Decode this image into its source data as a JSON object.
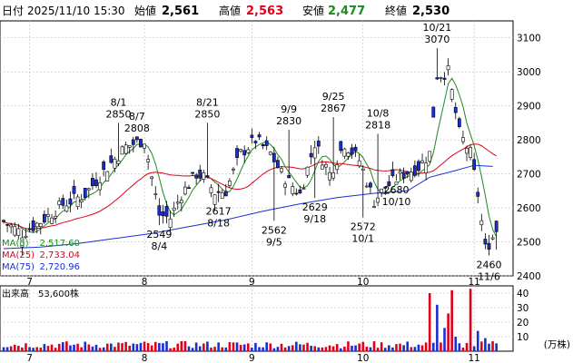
{
  "header": {
    "label_date": "日付",
    "date": "2025/11/10 15:30",
    "label_open": "始値",
    "open": "2,561",
    "label_high": "高値",
    "high": "2,563",
    "label_low": "安値",
    "low": "2,477",
    "label_close": "終値",
    "close": "2,530"
  },
  "colors": {
    "up": "#ffffff",
    "down": "#1a2fd0",
    "candle_outline": "#000000",
    "high_value": "#e0001a",
    "low_value": "#1f8a1f",
    "ma5": "#1f8a1f",
    "ma25": "#e0001a",
    "ma75": "#1a2fd0",
    "volume_up": "#e0001a",
    "volume_down": "#1a2fd0",
    "grid": "#bdbdbd"
  },
  "chart_data": [
    {
      "type": "candlestick",
      "ylim": [
        2400,
        3150
      ],
      "y_ticks": [
        "3100",
        "3000",
        "2900",
        "2800",
        "2700",
        "2600",
        "2500",
        "2400"
      ],
      "x_ticks": [
        "7",
        "8",
        "9",
        "10",
        "11"
      ],
      "annotations": [
        {
          "date": "8/1",
          "value": "2850",
          "position": "above"
        },
        {
          "date": "8/7",
          "value": "2808",
          "position": "above"
        },
        {
          "date": "8/21",
          "value": "2850",
          "position": "above"
        },
        {
          "date": "9/9",
          "value": "2830",
          "position": "above"
        },
        {
          "date": "9/25",
          "value": "2867",
          "position": "above"
        },
        {
          "date": "10/8",
          "value": "2818",
          "position": "above"
        },
        {
          "date": "10/21",
          "value": "3070",
          "position": "above"
        },
        {
          "date": "8/4",
          "value": "2549",
          "position": "below"
        },
        {
          "date": "8/18",
          "value": "2617",
          "position": "below"
        },
        {
          "date": "9/5",
          "value": "2562",
          "position": "below"
        },
        {
          "date": "9/18",
          "value": "2629",
          "position": "below"
        },
        {
          "date": "10/1",
          "value": "2572",
          "position": "below"
        },
        {
          "date": "10/10",
          "value": "2680",
          "position": "below"
        },
        {
          "date": "11/6",
          "value": "2460",
          "position": "below"
        }
      ],
      "moving_averages": [
        {
          "name": "MA(5)",
          "last": "2,517.60"
        },
        {
          "name": "MA(25)",
          "last": "2,733.04"
        },
        {
          "name": "MA(75)",
          "last": "2,720.96"
        }
      ],
      "ma75_points": [
        [
          0,
          2480
        ],
        [
          10,
          2485
        ],
        [
          20,
          2495
        ],
        [
          30,
          2510
        ],
        [
          40,
          2525
        ],
        [
          50,
          2545
        ],
        [
          60,
          2565
        ],
        [
          70,
          2590
        ],
        [
          80,
          2612
        ],
        [
          90,
          2630
        ],
        [
          100,
          2643
        ],
        [
          109,
          2650
        ],
        [
          115,
          2690
        ],
        [
          122,
          2710
        ],
        [
          127,
          2725
        ],
        [
          132,
          2722
        ]
      ]
    },
    {
      "type": "bar",
      "title": "出来高",
      "last_volume": "53,600株",
      "unit": "(万株)",
      "ylim": [
        0,
        45
      ],
      "y_ticks": [
        "40",
        "30",
        "20",
        "10"
      ]
    }
  ]
}
